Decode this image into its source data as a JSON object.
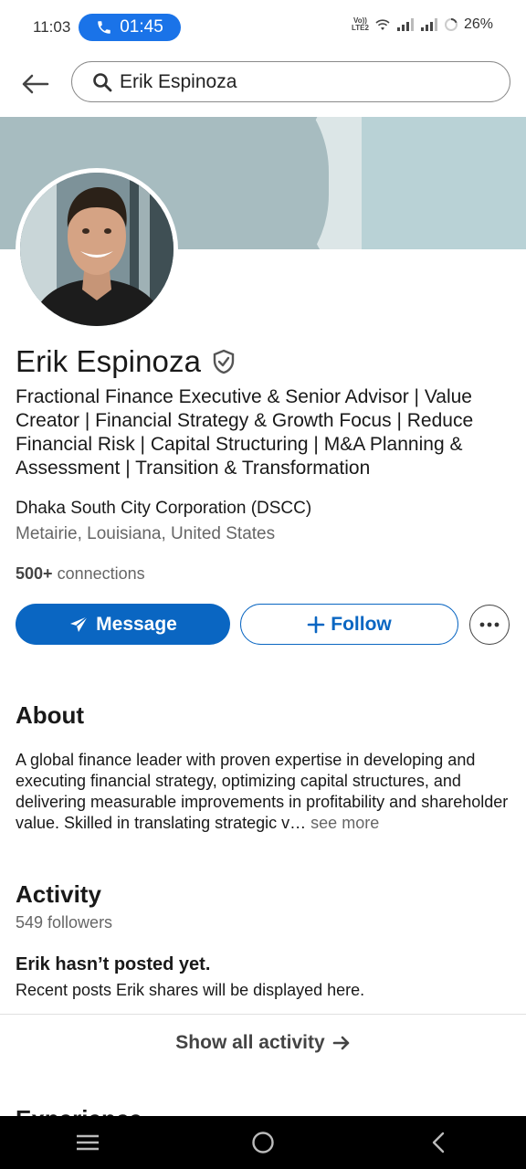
{
  "status_bar": {
    "time": "11:03",
    "call_timer": "01:45",
    "volte_top": "Vo))",
    "volte_bottom": "LTE2",
    "battery": "26%"
  },
  "search": {
    "query": "Erik Espinoza"
  },
  "profile": {
    "name": "Erik Espinoza",
    "headline": "Fractional Finance Executive & Senior Advisor | Value Creator | Financial Strategy & Growth Focus | Reduce Financial Risk | Capital Structuring | M&A Planning & Assessment | Transition & Transformation",
    "company": "Dhaka South City Corporation (DSCC)",
    "location": "Metairie, Louisiana, United States",
    "connections_count": "500+",
    "connections_label": "connections"
  },
  "actions": {
    "message_label": "Message",
    "follow_label": "Follow"
  },
  "about": {
    "title": "About",
    "text": "A global finance leader with proven expertise in developing and executing financial strategy, optimizing capital structures, and delivering measurable improvements in profitability and shareholder value. Skilled in translating strategic v",
    "ellipsis": "…",
    "see_more": "see more"
  },
  "activity": {
    "title": "Activity",
    "followers": "549 followers",
    "empty_title": "Erik hasn’t posted yet.",
    "empty_text": "Recent posts Erik shares will be displayed here.",
    "show_all": "Show all activity"
  },
  "next_section": {
    "title": "Experience"
  },
  "colors": {
    "primary": "#0a66c2",
    "call_pill": "#1a73e8",
    "banner": "#a7bcc0"
  }
}
